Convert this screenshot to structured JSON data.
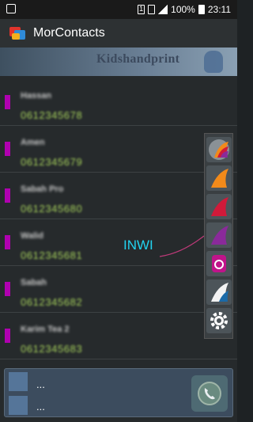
{
  "status": {
    "battery": "100%",
    "time": "23:11",
    "sim": "1"
  },
  "app": {
    "title": "MorContacts"
  },
  "banner": {
    "text": "Kidshandprint"
  },
  "contacts": [
    {
      "name": "Hassan",
      "number": "0612345678"
    },
    {
      "name": "Amen",
      "number": "0612345679"
    },
    {
      "name": "Sabah Pro",
      "number": "0612345680"
    },
    {
      "name": "Walid",
      "number": "0612345681"
    },
    {
      "name": "Sabah",
      "number": "0612345682"
    },
    {
      "name": "Karim Tea 2",
      "number": "0612345683"
    }
  ],
  "annotation": {
    "label": "INWI"
  },
  "operators": [
    "all",
    "orange",
    "maroc-telecom",
    "inwi",
    "contacts",
    "white",
    "settings"
  ],
  "bottom": {
    "line1": "...",
    "line2": "..."
  },
  "colors": {
    "contact_marker": "#b000b0",
    "number": "#a7d25c",
    "annotation": "#22d3f0"
  }
}
